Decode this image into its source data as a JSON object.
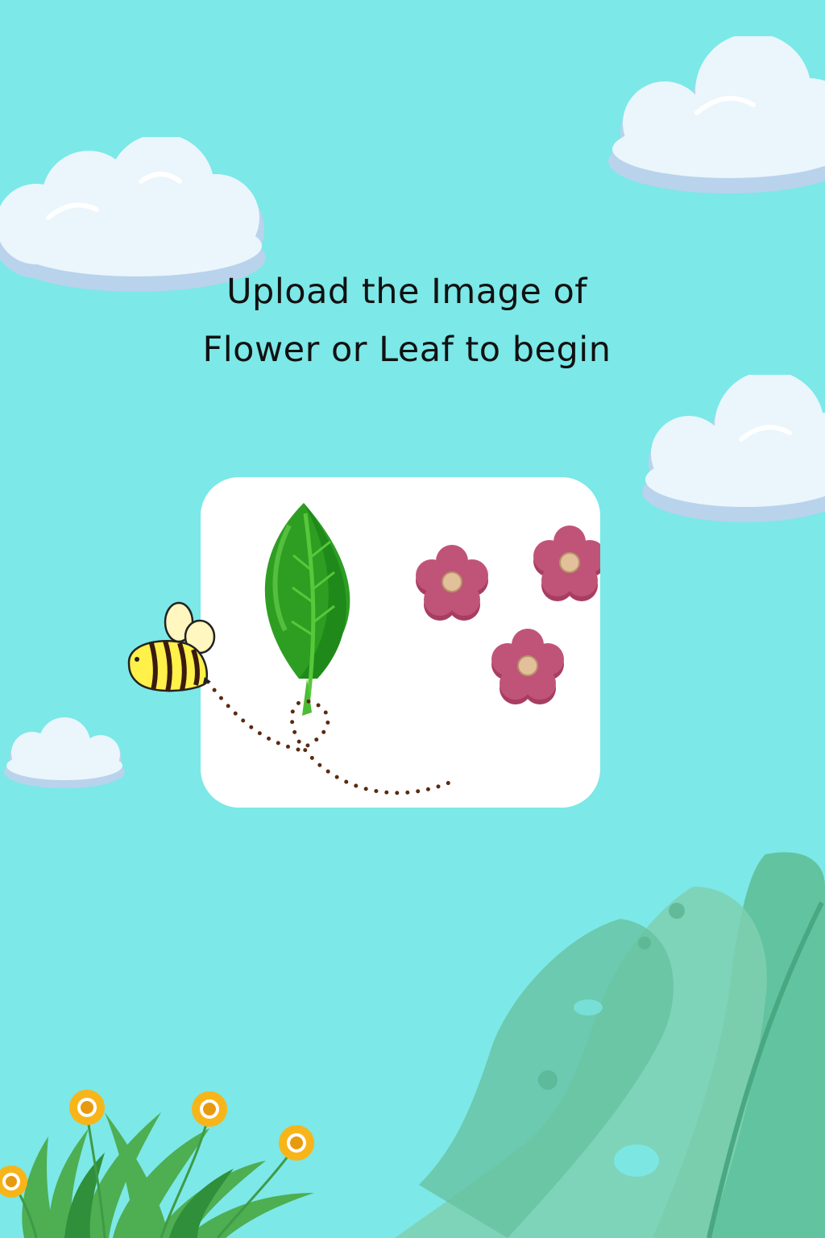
{
  "headline": {
    "line1": "Upload the Image of",
    "line2": "Flower or Leaf to begin"
  },
  "colors": {
    "background": "#7ce8e8",
    "card": "#ffffff",
    "cloud": "#eaf6fc",
    "cloud_shadow": "#b9d3ec",
    "leaf_dark": "#1f8a1a",
    "leaf_light": "#57c83a",
    "flower": "#c05478",
    "flower_center": "#e2c09a",
    "bee_body": "#fff04a",
    "bee_stripe": "#3a1a10",
    "monstera": "#63c4a6",
    "daisy": "#f7b51a"
  },
  "icons": {
    "upload_card": "leaf-and-flowers-icon",
    "mascot": "bee-icon"
  }
}
